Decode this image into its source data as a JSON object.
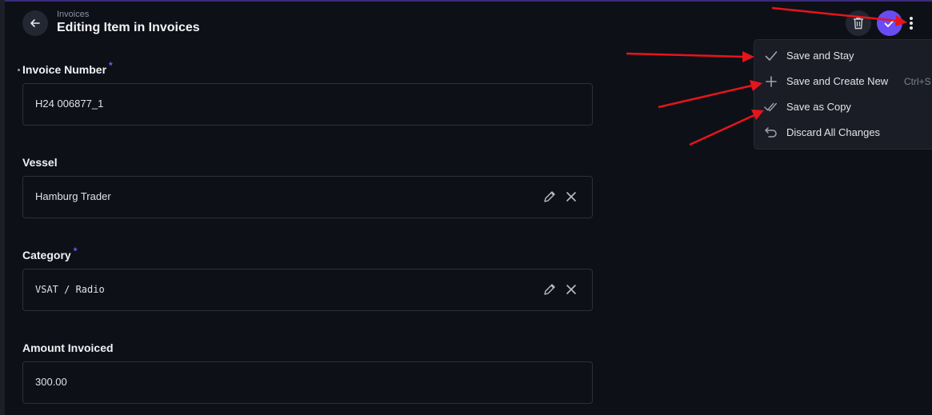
{
  "header": {
    "breadcrumb": "Invoices",
    "title": "Editing Item in Invoices"
  },
  "icons": {
    "back": "arrow-left-icon",
    "delete": "trash-icon",
    "save": "check-icon",
    "more": "more-vertical-icon"
  },
  "colors": {
    "accent": "#6a4cf5",
    "annotation_arrow": "#e8141b",
    "background": "#0e1017"
  },
  "form": {
    "invoice_number": {
      "label": "Invoice Number",
      "required_mark": "*",
      "value": "H24 006877_1"
    },
    "vessel": {
      "label": "Vessel",
      "value": "Hamburg Trader"
    },
    "category": {
      "label": "Category",
      "required_mark": "*",
      "value": "VSAT / Radio"
    },
    "amount": {
      "label": "Amount Invoiced",
      "value": "300.00"
    }
  },
  "menu": {
    "items": [
      {
        "label": "Save and Stay",
        "icon": "check-icon",
        "shortcut": ""
      },
      {
        "label": "Save and Create New",
        "icon": "plus-icon",
        "shortcut": "Ctrl+S"
      },
      {
        "label": "Save as Copy",
        "icon": "double-check-icon",
        "shortcut": ""
      },
      {
        "label": "Discard All Changes",
        "icon": "undo-icon",
        "shortcut": ""
      }
    ]
  }
}
